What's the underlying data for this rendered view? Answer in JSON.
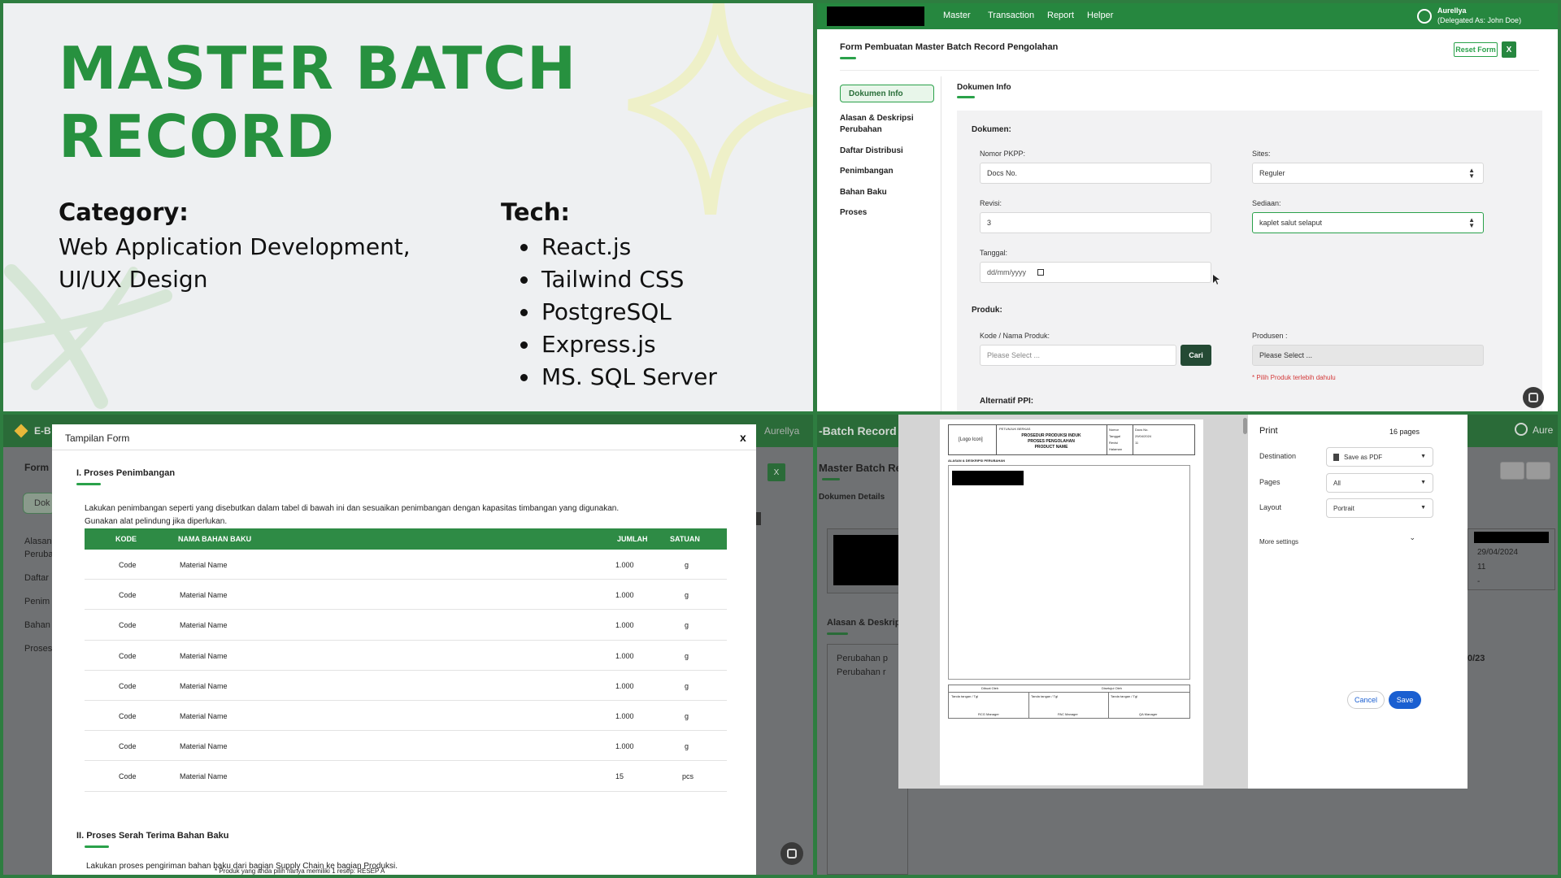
{
  "panel1": {
    "title_line1": "MASTER BATCH",
    "title_line2": "RECORD",
    "category_heading": "Category:",
    "category_line1": "Web Application Development,",
    "category_line2": "UI/UX Design",
    "tech_heading": "Tech:",
    "tech_items": [
      "React.js",
      "Tailwind CSS",
      "PostgreSQL",
      "Express.js",
      "MS. SQL Server"
    ],
    "colors": {
      "accent": "#27913f",
      "background": "#eef0f2"
    }
  },
  "panel2": {
    "nav": {
      "items": [
        "Master",
        "Transaction",
        "Report",
        "Helper"
      ],
      "user_name": "Aurellya",
      "user_delegation": "(Delegated As:  John Doe)"
    },
    "form_title": "Form Pembuatan Master Batch Record Pengolahan",
    "reset_button": "Reset Form",
    "close_button": "X",
    "sidebar": {
      "active": "Dokumen Info",
      "items": [
        "Alasan & Deskripsi",
        "Perubahan",
        "Daftar Distribusi",
        "Penimbangan",
        "Bahan Baku",
        "Proses"
      ]
    },
    "section_tab": "Dokumen Info",
    "dokumen": {
      "heading": "Dokumen:",
      "nomor_label": "Nomor PKPP:",
      "nomor_value": "Docs No.",
      "sites_label": "Sites:",
      "sites_value": "Reguler",
      "revisi_label": "Revisi:",
      "revisi_value": "3",
      "sediaan_label": "Sediaan:",
      "sediaan_value": "kaplet salut selaput",
      "tanggal_label": "Tanggal:",
      "tanggal_placeholder": "dd/mm/yyyy"
    },
    "produk": {
      "heading": "Produk:",
      "kode_label": "Kode / Nama Produk:",
      "kode_placeholder": "Please Select ...",
      "cari_button": "Cari",
      "produsen_label": "Produsen :",
      "produsen_placeholder": "Please Select ...",
      "error": "* Pilih Produk terlebih dahulu"
    },
    "alternatif_heading": "Alternatif PPI:"
  },
  "panel3": {
    "bg_logo": "E-B",
    "bg_user": "Aurellya",
    "bg_form": "Form",
    "bg_dok": "Dok",
    "bg_close": "X",
    "bg_side": [
      "Alasan",
      "Perubah",
      "Daftar",
      "Penim",
      "Bahan",
      "Proses"
    ],
    "modal_title": "Tampilan Form",
    "modal_close": "x",
    "section1_title": "I. Proses Penimbangan",
    "section1_desc_line1": "Lakukan penimbangan seperti yang disebutkan dalam tabel di bawah ini dan sesuaikan penimbangan dengan kapasitas timbangan yang digunakan.",
    "section1_desc_line2": "Gunakan alat pelindung jika diperlukan.",
    "table_headers": [
      "KODE",
      "NAMA BAHAN BAKU",
      "JUMLAH",
      "SATUAN"
    ],
    "table_rows": [
      [
        "Code",
        "Material Name",
        "1.000",
        "g"
      ],
      [
        "Code",
        "Material Name",
        "1.000",
        "g"
      ],
      [
        "Code",
        "Material Name",
        "1.000",
        "g"
      ],
      [
        "Code",
        "Material Name",
        "1.000",
        "g"
      ],
      [
        "Code",
        "Material Name",
        "1.000",
        "g"
      ],
      [
        "Code",
        "Material Name",
        "1.000",
        "g"
      ],
      [
        "Code",
        "Material Name",
        "1.000",
        "g"
      ],
      [
        "Code",
        "Material Name",
        "15",
        "pcs"
      ]
    ],
    "section2_title": "II. Proses Serah Terima Bahan Baku",
    "section2_desc": "Lakukan proses pengiriman bahan baku dari bagian Supply Chain ke bagian Produksi.",
    "bottom_note": "* Produk yang anda pilih hanya memiliki 1 resep: RESEP A"
  },
  "panel4": {
    "bg_title": "-Batch Record",
    "bg_user": "Aure",
    "bg_heading": "Master Batch Re",
    "bg_subheading": "Dokumen Details",
    "bg_date": "29/04/2024",
    "bg_rev": "11",
    "bg_dash": "-",
    "bg_alasan": "Alasan & Deskrip",
    "bg_list": [
      "Perubahan p",
      "Perubahan r"
    ],
    "bg_right_num": "0/23",
    "print": {
      "title": "Print",
      "pages_count": "16 pages",
      "destination_label": "Destination",
      "destination_value": "Save as PDF",
      "pages_label": "Pages",
      "pages_value": "All",
      "layout_label": "Layout",
      "layout_value": "Portrait",
      "more_settings": "More settings",
      "cancel": "Cancel",
      "save": "Save"
    },
    "doc": {
      "logo": "[Logo Icon]",
      "head_small": "PETUNJUK BERKAS",
      "title_line1": "PROSEDUR PRODUKSI INDUK",
      "title_line2": "PROSES PENGOLAHAN",
      "title_line3": "PRODUCT NAME",
      "meta_labels": [
        "Nomor",
        "Tanggal",
        "Revisi",
        "Halaman"
      ],
      "meta_values": [
        "Docs No.",
        "29/04/2024",
        "11",
        ""
      ],
      "section": "ALASAN & DESKRIPSI PERUBAHAN",
      "sign_titles": [
        "Dibuat Oleh",
        "Disetujui Oleh"
      ],
      "sign_text": "Tanda tangan / Tgl",
      "sign_roles": [
        "RCG Manager",
        "PAC Manager",
        "QA Manager"
      ]
    }
  }
}
